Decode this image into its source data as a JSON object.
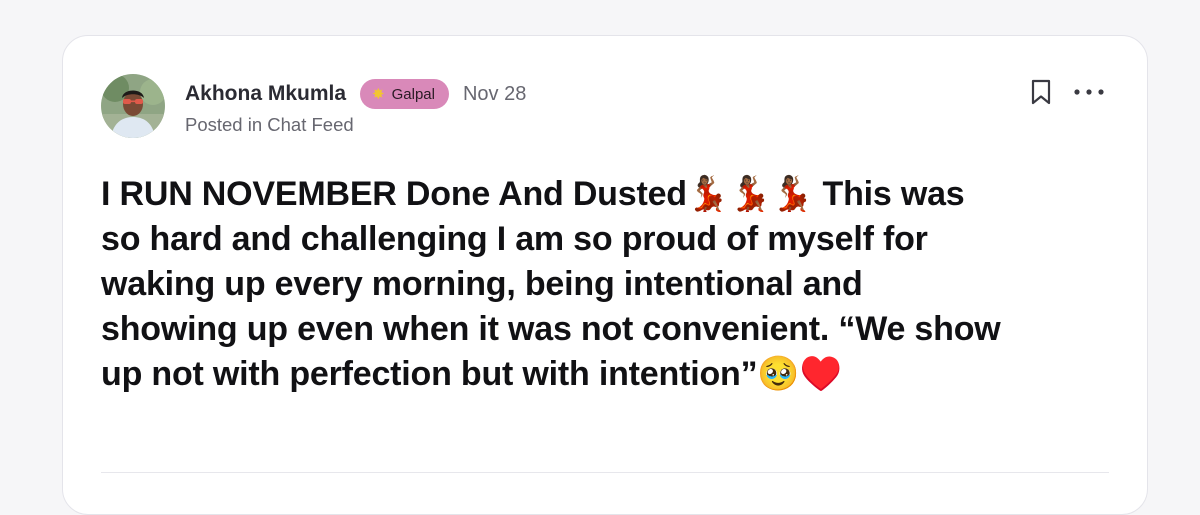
{
  "post": {
    "author": {
      "name": "Akhona Mkumla",
      "avatar_icon": "user-avatar-photo"
    },
    "badge": {
      "label": "Galpal",
      "icon": "star-icon",
      "color": "#d989b9"
    },
    "date": "Nov 28",
    "posted_in": "Posted in Chat Feed",
    "body": "I RUN NOVEMBER Done And Dusted💃🏾💃🏾💃🏾 This was so hard and challenging I am so proud of myself for waking up every morning, being intentional and showing up even when it was not convenient. “We show up not with perfection but with intention”🥹♥️",
    "actions": {
      "bookmark_icon": "bookmark-icon",
      "more_icon": "more-options-icon"
    }
  }
}
